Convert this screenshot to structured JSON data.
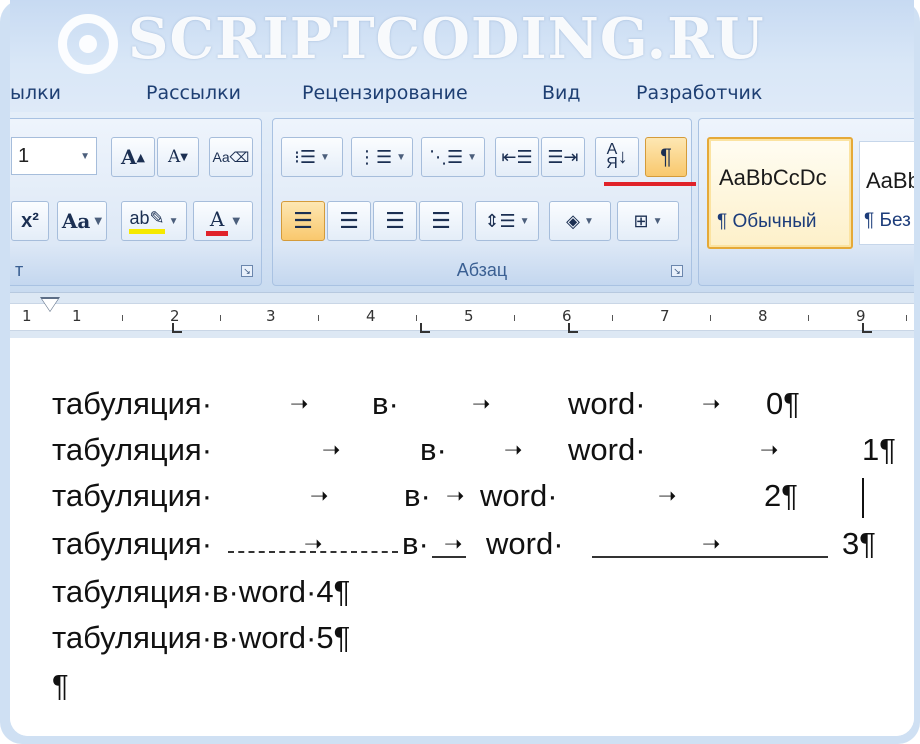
{
  "watermark": {
    "text": "SCRIPTCODING.RU"
  },
  "ribbon_tabs": [
    {
      "label": "ылки"
    },
    {
      "label": "Рассылки"
    },
    {
      "label": "Рецензирование"
    },
    {
      "label": "Вид"
    },
    {
      "label": "Разработчик"
    }
  ],
  "font_group": {
    "font_size_value": "1",
    "label": "т",
    "grow_label": "A",
    "shrink_label": "A",
    "case_label": "Aa"
  },
  "paragraph_group": {
    "label": "Абзац",
    "show_marks_label": "¶"
  },
  "styles": [
    {
      "sample": "AaBbCcDc",
      "name": "¶ Обычный"
    },
    {
      "sample": "AaBb",
      "name": "¶ Без"
    }
  ],
  "ruler": {
    "numbers": [
      "1",
      "1",
      "2",
      "3",
      "4",
      "5",
      "6",
      "7",
      "8",
      "9"
    ]
  },
  "document": {
    "lines": [
      {
        "parts": [
          "табуляция·",
          "в·",
          "word·",
          "0¶"
        ]
      },
      {
        "parts": [
          "табуляция·",
          "в·",
          "word·",
          "1¶"
        ]
      },
      {
        "parts": [
          "табуляция·",
          "в·",
          "word·",
          "2¶"
        ]
      },
      {
        "parts": [
          "табуляция·",
          "в·",
          "word·",
          "3¶"
        ]
      },
      {
        "text": "табуляция·в·word·4¶"
      },
      {
        "text": "табуляция·в·word·5¶"
      },
      {
        "text": "¶"
      }
    ],
    "tab_arrow": "➝"
  },
  "colors": {
    "accent_red": "#e0222a",
    "active_button": "#f9c86d",
    "ribbon_blue": "#d5e3f4"
  }
}
